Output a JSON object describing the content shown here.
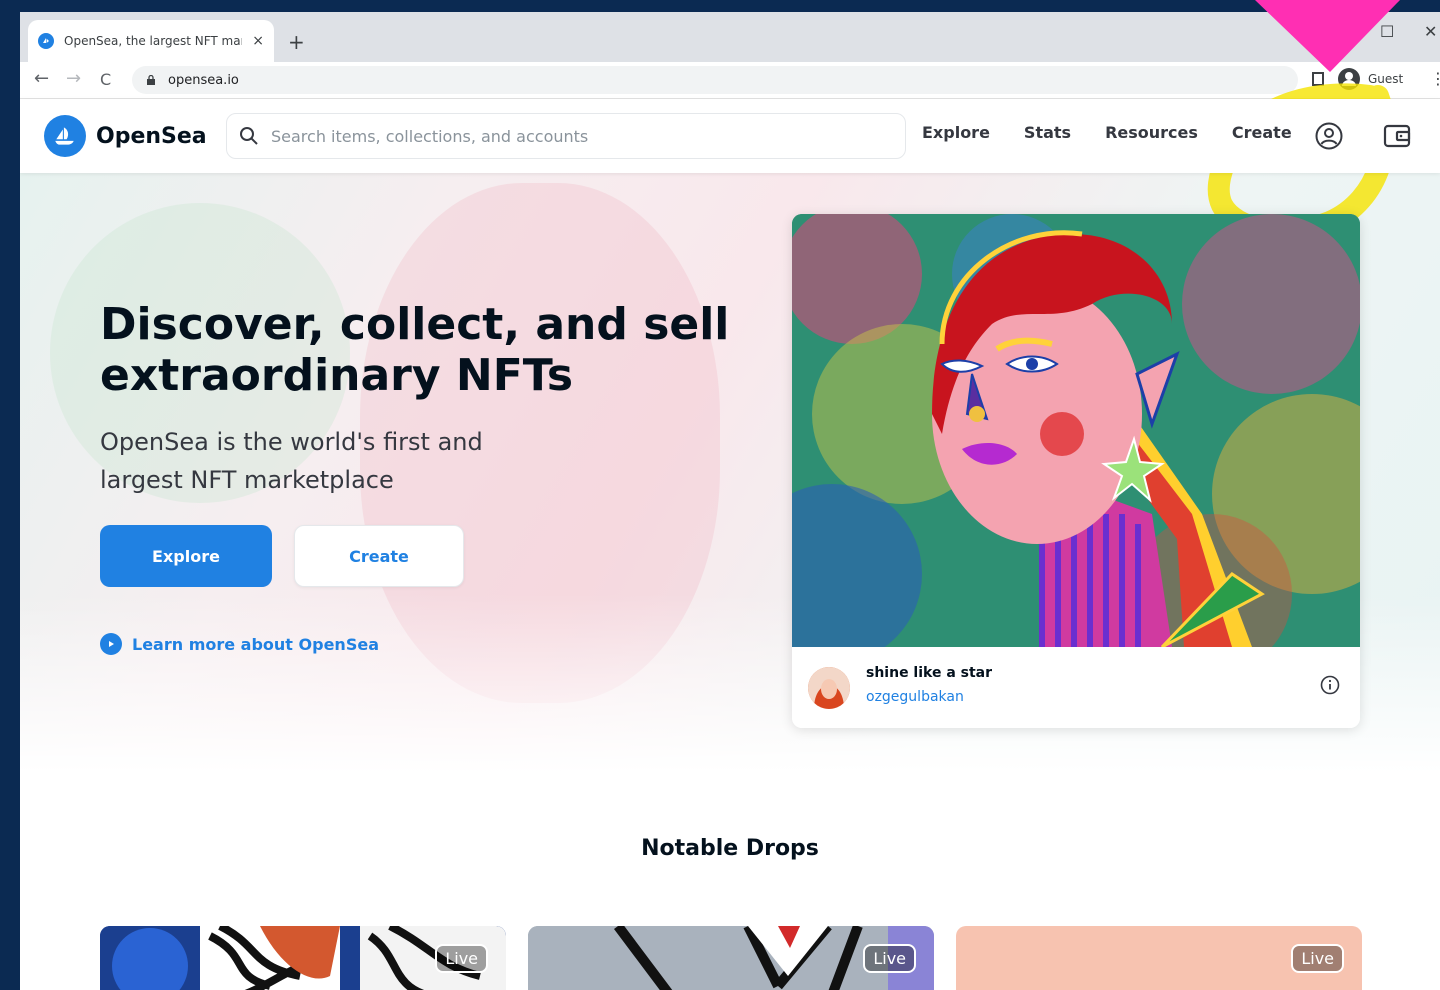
{
  "browser": {
    "tab_title": "OpenSea, the largest NFT marketplace",
    "tab_close": "×",
    "new_tab": "+",
    "url": "opensea.io",
    "profile_label": "Guest",
    "menu": "⋮",
    "back": "←",
    "forward": "→",
    "reload": "C",
    "window_maximize": "☐",
    "window_close": "✕"
  },
  "header": {
    "brand": "OpenSea",
    "search_placeholder": "Search items, collections, and accounts",
    "nav": [
      "Explore",
      "Stats",
      "Resources",
      "Create"
    ]
  },
  "hero": {
    "headline": "Discover, collect, and sell extraordinary NFTs",
    "subheadline": "OpenSea is the world's first and largest NFT marketplace",
    "primary_button": "Explore",
    "secondary_button": "Create",
    "learn_more": "Learn more about OpenSea"
  },
  "featured": {
    "title": "shine like a star",
    "author": "ozgegulbakan"
  },
  "notable": {
    "title": "Notable Drops",
    "drops": [
      {
        "badge": "Live",
        "color": "#1b3f8f"
      },
      {
        "badge": "Live",
        "color": "#9aa4b0"
      },
      {
        "badge": "Live",
        "color": "#f7c3b0"
      }
    ]
  },
  "colors": {
    "brand_blue": "#2081e2",
    "annotation_yellow": "#f5e400",
    "annotation_pink": "#ff2fb3",
    "backdrop": "#0b2a52"
  }
}
